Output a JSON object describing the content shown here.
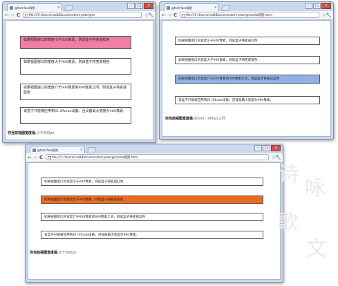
{
  "tab_title": "@font-face规则",
  "address": "file:///C:/Users/css8/Documents/mysite/@media规则.html",
  "address_w1": "file:///C:/Users/css8/Documents/mysite/@m",
  "tab_close_glyph": "×",
  "window_controls": {
    "minimize": "–",
    "maximize": "□",
    "close": "x"
  },
  "icons": {
    "back": "←",
    "forward": "→",
    "reload": "C",
    "star": "☆",
    "wrench": "🔧"
  },
  "colors": {
    "pink": "#ef7fa7",
    "blue": "#8fb1e6",
    "orange": "#ed6b1f"
  },
  "boxes": [
    "如果视图窗口的宽度小于600像素，则该盒子将变成红色",
    "如果视图窗口的宽度大于900像素，则该盒子将变成橙色",
    "如果视图窗口的宽度介于600像素到900像素之间，则该盒子将变成蓝色",
    "该盒子只能被应用到IE iPhone设备，且设备最大宽度为480像素。"
  ],
  "result_label": "你当前视图宽度是:",
  "windows": [
    {
      "result_value": "小于600px",
      "highlighted_box": 1
    },
    {
      "result_value": "在600 - 900px之间",
      "highlighted_box": 3
    },
    {
      "result_value": "大于900px",
      "highlighted_box": 2
    }
  ],
  "watermark": [
    "诗",
    "咏",
    "歌",
    "文"
  ]
}
